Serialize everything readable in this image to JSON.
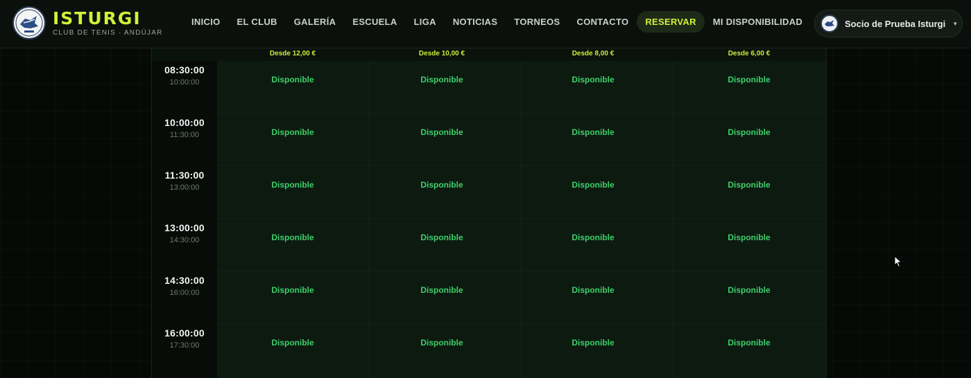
{
  "header": {
    "brand_name": "ISTURGI",
    "brand_sub": "CLUB DE TENIS · ANDÚJAR",
    "nav": [
      {
        "label": "INICIO",
        "name": "nav-inicio",
        "active": false
      },
      {
        "label": "EL CLUB",
        "name": "nav-el-club",
        "active": false
      },
      {
        "label": "GALERÍA",
        "name": "nav-galeria",
        "active": false
      },
      {
        "label": "ESCUELA",
        "name": "nav-escuela",
        "active": false
      },
      {
        "label": "LIGA",
        "name": "nav-liga",
        "active": false
      },
      {
        "label": "NOTICIAS",
        "name": "nav-noticias",
        "active": false
      },
      {
        "label": "TORNEOS",
        "name": "nav-torneos",
        "active": false
      },
      {
        "label": "CONTACTO",
        "name": "nav-contacto",
        "active": false
      },
      {
        "label": "RESERVAR",
        "name": "nav-reservar",
        "active": true
      },
      {
        "label": "MI DISPONIBILIDAD",
        "name": "nav-mi-disponibilidad",
        "active": false
      }
    ],
    "user_name": "Socio de Prueba Isturgi",
    "caret_icon": "caret-down-icon"
  },
  "schedule": {
    "prices": [
      "Desde 12,00 €",
      "Desde 10,00 €",
      "Desde 8,00 €",
      "Desde 6,00 €"
    ],
    "slots": [
      {
        "start": "08:30:00",
        "end": "10:00:00",
        "status": [
          "Disponible",
          "Disponible",
          "Disponible",
          "Disponible"
        ]
      },
      {
        "start": "10:00:00",
        "end": "11:30:00",
        "status": [
          "Disponible",
          "Disponible",
          "Disponible",
          "Disponible"
        ]
      },
      {
        "start": "11:30:00",
        "end": "13:00:00",
        "status": [
          "Disponible",
          "Disponible",
          "Disponible",
          "Disponible"
        ]
      },
      {
        "start": "13:00:00",
        "end": "14:30:00",
        "status": [
          "Disponible",
          "Disponible",
          "Disponible",
          "Disponible"
        ]
      },
      {
        "start": "14:30:00",
        "end": "16:00:00",
        "status": [
          "Disponible",
          "Disponible",
          "Disponible",
          "Disponible"
        ]
      },
      {
        "start": "16:00:00",
        "end": "17:30:00",
        "status": [
          "Disponible",
          "Disponible",
          "Disponible",
          "Disponible"
        ]
      }
    ]
  },
  "colors": {
    "accent": "#d3f03a",
    "available": "#3fcf6a",
    "background": "#060a07"
  }
}
